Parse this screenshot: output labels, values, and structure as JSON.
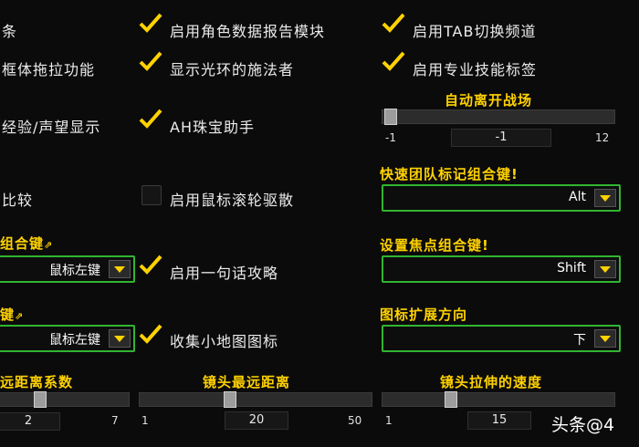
{
  "col1": {
    "row1_label": "条",
    "row2_label": "框体拖拉功能",
    "row3_label": "经验/声望显示",
    "row4_label": "比较",
    "combo1_title": "组合键",
    "combo1_value": "鼠标左键",
    "combo2_title": "键",
    "combo2_value": "鼠标左键",
    "slider_title": "远距离系数",
    "slider_value": "2",
    "slider_max": "7",
    "slider_position": 0.3
  },
  "col2": {
    "items": [
      {
        "label": "启用角色数据报告模块",
        "checked": true
      },
      {
        "label": "显示光环的施法者",
        "checked": true
      },
      {
        "label": "AH珠宝助手",
        "checked": true
      },
      {
        "label": "启用鼠标滚轮驱散",
        "checked": false
      },
      {
        "label": "启用一句话攻略",
        "checked": true
      },
      {
        "label": "收集小地图图标",
        "checked": true
      }
    ],
    "slider_title": "镜头最远距离",
    "slider_min": "1",
    "slider_value": "20",
    "slider_max": "50",
    "slider_position": 0.388
  },
  "col3": {
    "items": [
      {
        "label": "启用TAB切换频道",
        "checked": true
      },
      {
        "label": "启用专业技能标签",
        "checked": true
      }
    ],
    "auto_leave_title": "自动离开战场",
    "auto_leave_min": "-1",
    "auto_leave_value": "-1",
    "auto_leave_max": "12",
    "auto_leave_position": 0.0,
    "quick_mark_title": "快速团队标记组合键!",
    "quick_mark_value": "Alt",
    "focus_title": "设置焦点组合键!",
    "focus_value": "Shift",
    "icon_dir_title": "图标扩展方向",
    "icon_dir_value": "下",
    "lens_speed_title": "镜头拉伸的速度",
    "lens_speed_min": "1",
    "lens_speed_value": "15",
    "lens_speed_position": 0.28
  },
  "watermark": "头条@4",
  "colors": {
    "check": "#ffd200",
    "dropdown_border": "#31b531",
    "title_yellow": "#ffd200"
  }
}
